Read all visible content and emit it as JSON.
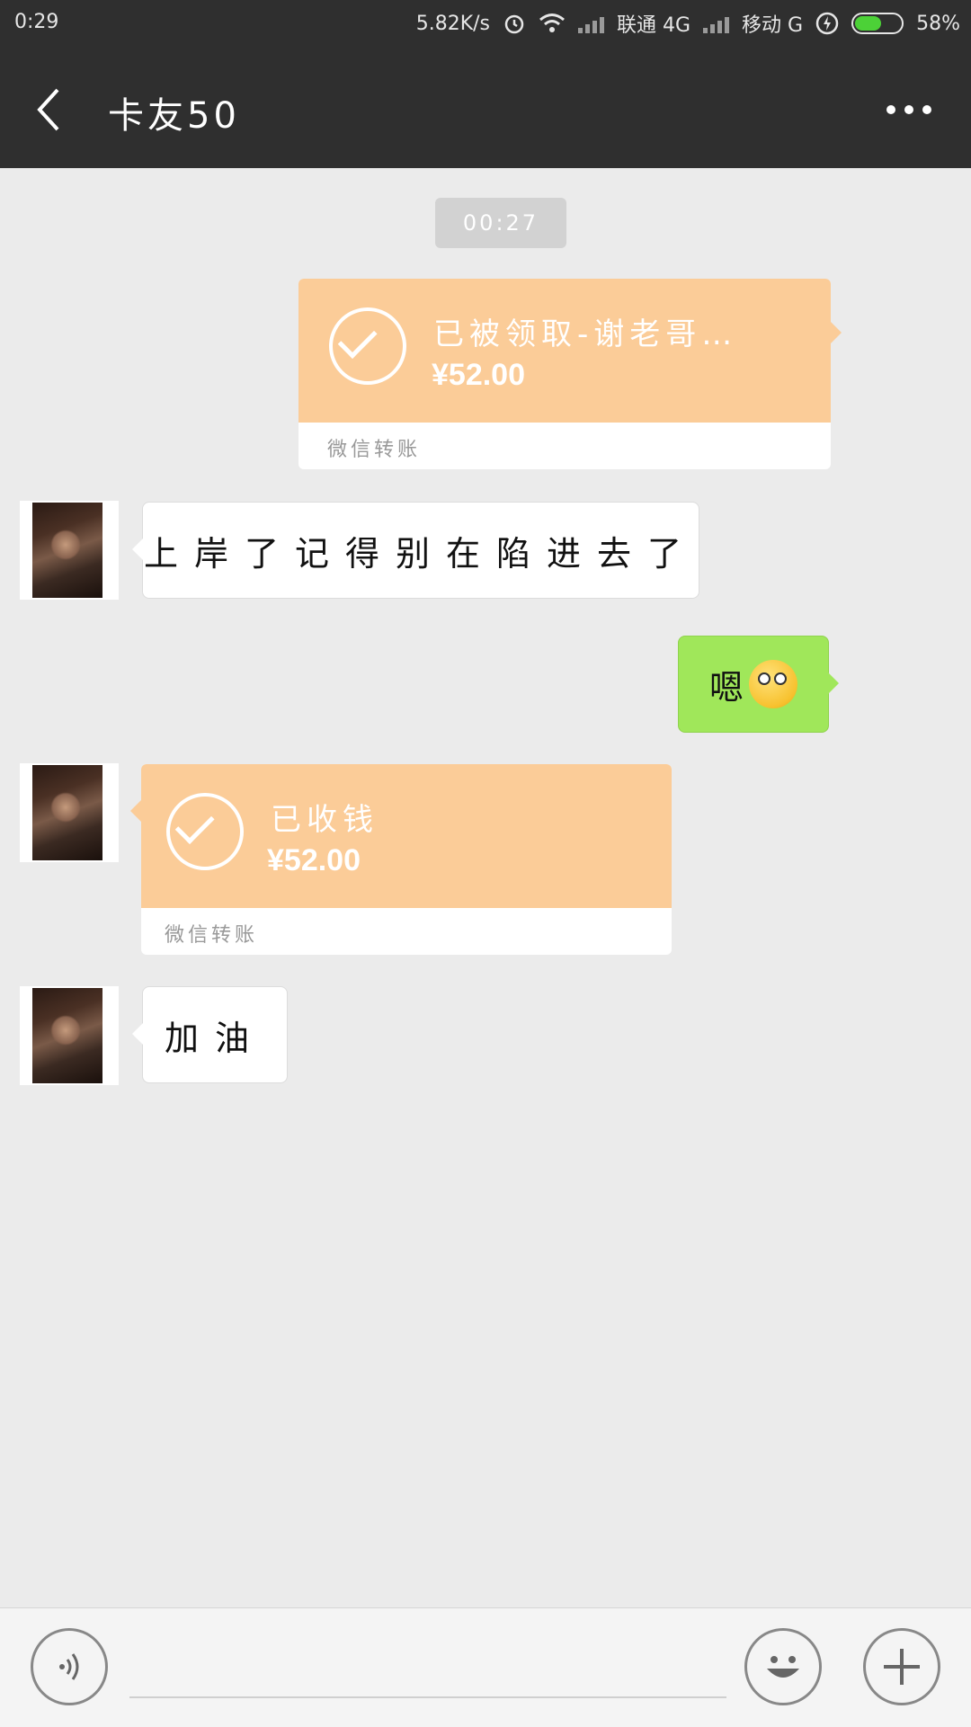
{
  "status_bar": {
    "time": "0:29",
    "net_speed": "5.82K/s",
    "carrier1": "联通 4G",
    "carrier2": "移动 G",
    "battery": "58%",
    "battery_level": 0.58
  },
  "header": {
    "back_icon": "chevron-left-icon",
    "title": "卡友50",
    "more_icon": "more-dots-icon"
  },
  "chat": {
    "timestamp": "00:27",
    "messages": [
      {
        "type": "transfer",
        "side": "right",
        "status": "已被领取-谢老哥…",
        "amount": "¥52.00",
        "footer": "微信转账"
      },
      {
        "type": "text",
        "side": "left",
        "text": "上岸了记得别在陷进去了"
      },
      {
        "type": "text",
        "side": "right",
        "text": "嗯"
      },
      {
        "type": "transfer",
        "side": "left",
        "status": "已收钱",
        "amount": "¥52.00",
        "footer": "微信转账"
      },
      {
        "type": "text",
        "side": "left",
        "text": "加油"
      }
    ]
  },
  "input_bar": {
    "voice_icon": "voice-icon",
    "emoji_icon": "emoji-icon",
    "plus_icon": "plus-icon",
    "input_placeholder": ""
  },
  "colors": {
    "header_bg": "#2f2f2f",
    "transfer_orange": "#fbcc98",
    "own_bubble_green": "#a0e75a",
    "chat_bg": "#ebebeb"
  }
}
